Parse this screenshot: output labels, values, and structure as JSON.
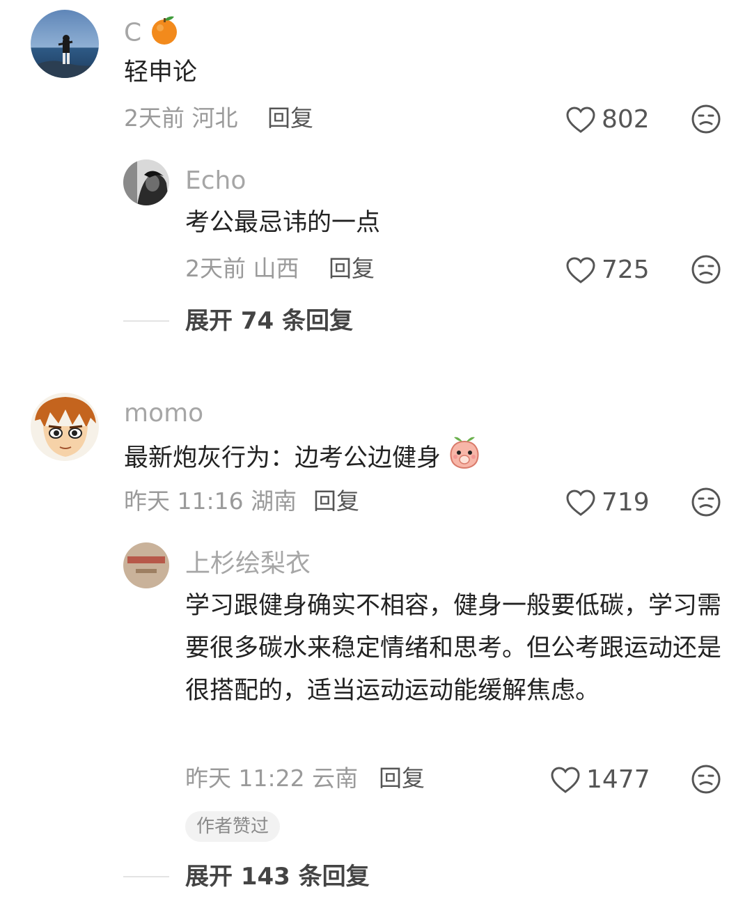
{
  "comments": [
    {
      "username": "C",
      "username_emoji": "orange-emoji",
      "text": "轻申论",
      "meta": "2天前 河北",
      "reply_label": "回复",
      "likes": "802",
      "replies": [
        {
          "username": "Echo",
          "text": "考公最忌讳的一点",
          "meta": "2天前 山西",
          "reply_label": "回复",
          "likes": "725"
        }
      ],
      "expand_label": "展开 74 条回复"
    },
    {
      "username": "momo",
      "text": "最新炮灰行为：边考公边健身",
      "text_emoji": "peach-covering-mouth-emoji",
      "meta": "昨天 11:16 湖南",
      "reply_label": "回复",
      "likes": "719",
      "replies": [
        {
          "username": "上杉绘梨衣",
          "text": "学习跟健身确实不相容，健身一般要低碳，学习需要很多碳水来稳定情绪和思考。但公考跟运动还是很搭配的，适当运动运动能缓解焦虑。",
          "meta": "昨天 11:22 云南",
          "reply_label": "回复",
          "likes": "1477",
          "badge": "作者赞过"
        }
      ],
      "expand_label": "展开 143 条回复"
    }
  ],
  "colors": {
    "username": "#a6a6a6",
    "meta": "#9a9a9a",
    "text": "#222222",
    "icon": "#555555"
  }
}
